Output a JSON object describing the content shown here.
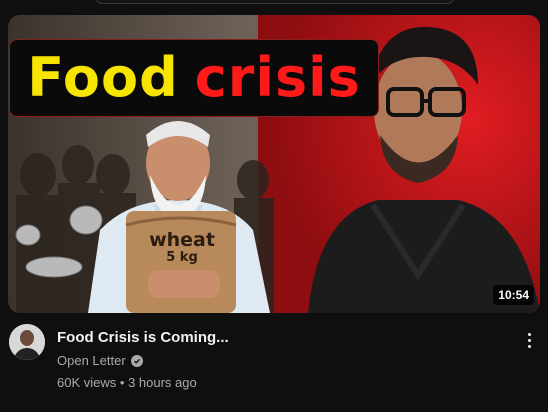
{
  "thumbnail": {
    "headline_word1": "Food",
    "headline_word2": "crisis",
    "sack_line1": "wheat",
    "sack_line2": "5 kg",
    "duration": "10:54",
    "colors": {
      "headline_yellow": "#f7e400",
      "headline_red": "#ff1a1a",
      "background_red": "#c4151c"
    }
  },
  "video": {
    "title": "Food Crisis is Coming...",
    "channel": "Open Letter",
    "views": "60K views",
    "separator": "•",
    "age": "3 hours ago"
  },
  "icons": {
    "verified": "verified-check-icon",
    "more": "more-vert-icon"
  }
}
